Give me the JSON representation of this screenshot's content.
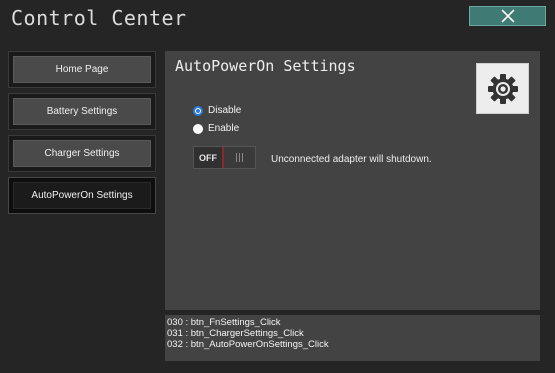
{
  "window": {
    "title": "Control Center",
    "close_icon": "close-icon"
  },
  "sidebar": {
    "items": [
      {
        "label": "Home Page",
        "active": false
      },
      {
        "label": "Battery Settings",
        "active": false
      },
      {
        "label": "Charger Settings",
        "active": false
      },
      {
        "label": "AutoPowerOn Settings",
        "active": true
      }
    ]
  },
  "main": {
    "title": "AutoPowerOn Settings",
    "settings_icon": "gear-icon",
    "options": [
      {
        "label": "Disable",
        "checked": true
      },
      {
        "label": "Enable",
        "checked": false
      }
    ],
    "toggle": {
      "state_label": "OFF",
      "state": "off"
    },
    "toggle_description": "Unconnected adapter will shutdown."
  },
  "log": {
    "lines": [
      "030 : btn_FnSettings_Click",
      "031 : btn_ChargerSettings_Click",
      "032 : btn_AutoPowerOnSettings_Click"
    ]
  },
  "colors": {
    "background": "#252525",
    "panel": "#434343",
    "close_button": "#3f7b74",
    "radio_accent": "#2b7bd6",
    "toggle_off_accent": "#8b2a2a"
  }
}
